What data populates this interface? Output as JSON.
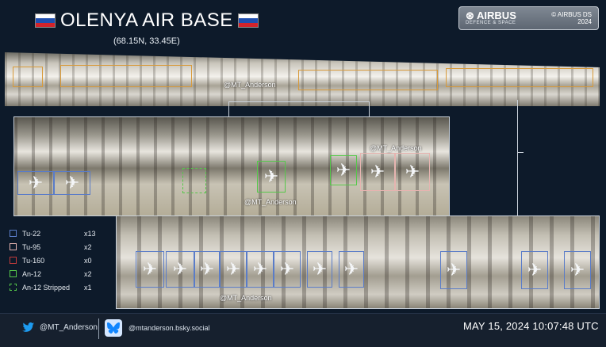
{
  "header": {
    "title": "OLENYA AIR BASE",
    "coordinates": "(68.15N, 33.45E)"
  },
  "badge": {
    "logo": "AIRBUS",
    "subtitle": "DEFENCE & SPACE",
    "copyright": "© AIRBUS DS",
    "year": "2024"
  },
  "watermarks": {
    "top": "@MT_Anderson",
    "middle_a": "@MT_Anderson",
    "middle_b": "@MT_Anderson",
    "bottom": "@MT_Anderson"
  },
  "legend": [
    {
      "name": "Tu-22",
      "count": "x13",
      "color": "#5a7cc8",
      "style": "solid"
    },
    {
      "name": "Tu-95",
      "count": "x2",
      "color": "#e6b4b0",
      "style": "solid"
    },
    {
      "name": "Tu-160",
      "count": "x0",
      "color": "#c43b3b",
      "style": "solid"
    },
    {
      "name": "An-12",
      "count": "x2",
      "color": "#55c84a",
      "style": "solid"
    },
    {
      "name": "An-12 Stripped",
      "count": "x1",
      "color": "#55c84a",
      "style": "dashed"
    }
  ],
  "footer": {
    "twitter_handle": "@MT_Anderson",
    "bluesky_handle": "@mtanderson.bsky.social",
    "timestamp": "MAY 15, 2024 10:07:48 UTC"
  },
  "icons": {
    "twitter": "twitter-bird-icon",
    "bluesky": "bluesky-butterfly-icon",
    "flag": "russia-flag-icon",
    "plane": "aircraft-icon"
  },
  "colors": {
    "background": "#0d1a2a",
    "tu22_box": "#5a7cc8",
    "tu95_box": "#e6b4b0",
    "an12_box": "#55c84a",
    "overview_box": "#d89a3a"
  }
}
